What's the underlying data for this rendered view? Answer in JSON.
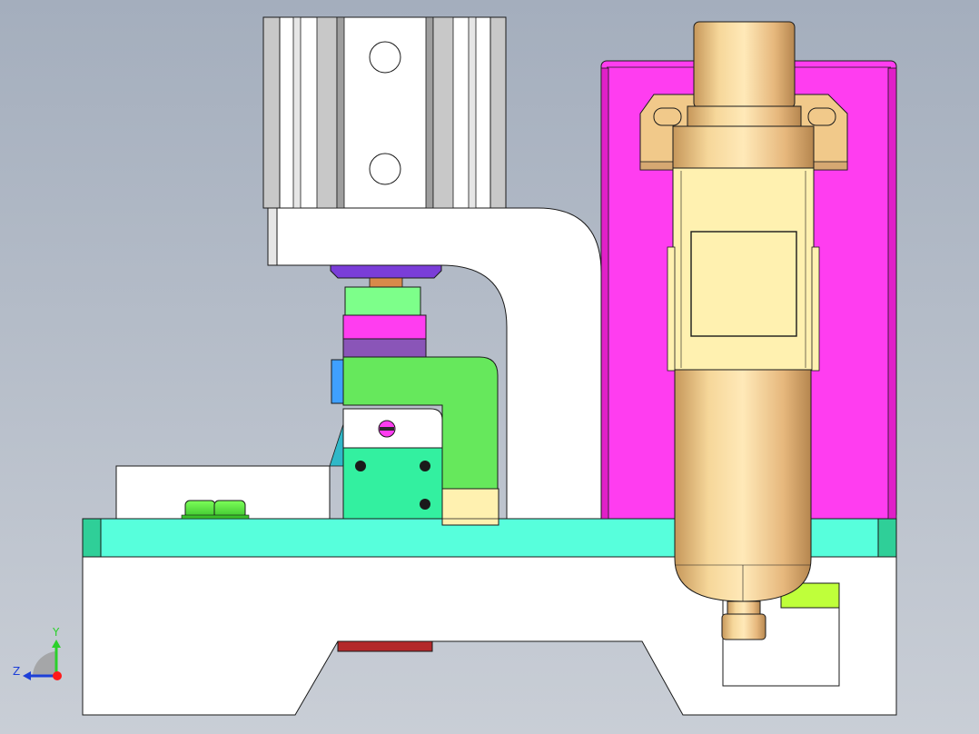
{
  "viewport": {
    "background_top": "#a4aebd",
    "background_bottom": "#c9ced6"
  },
  "colors": {
    "outline": "#1a1a1a",
    "white_part": "#ffffff",
    "light_gray": "#e6e6e6",
    "mid_gray": "#c8c8c8",
    "cyan_plate": "#57ffdc",
    "cyan_dark": "#2fcf98",
    "green_bright": "#66e85c",
    "green_light": "#7dff8a",
    "green_block": "#33f0a0",
    "magenta": "#ff3df0",
    "magenta_side": "#e020c8",
    "purple": "#8a55b8",
    "violet": "#7a3dd8",
    "blue_tab": "#3fa0ff",
    "red_bar": "#b3282a",
    "yellow_green": "#bfff3a",
    "gold_light": "#ffe9a8",
    "gold_mid": "#f1c98a",
    "gold_dark": "#c6975a",
    "cream": "#fff1b0",
    "copper": "#d88a4a"
  },
  "triad": {
    "y_label": "Y",
    "z_label": "Z",
    "y_color": "#2bd12b",
    "z_color": "#1d3fd8",
    "origin_color": "#ff1a1a"
  }
}
